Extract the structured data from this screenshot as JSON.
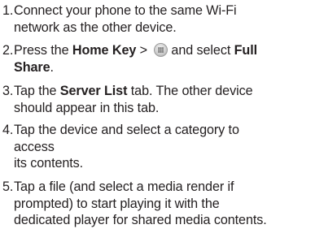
{
  "steps": [
    {
      "number": "1.",
      "lines": [
        "Connect your phone to the same Wi-Fi",
        "network as the other device."
      ]
    },
    {
      "number": "2.",
      "pre": "Press the ",
      "bold1": "Home Key",
      "mid": " > ",
      "icon": "apps-grid-icon",
      "post": "and select ",
      "bold2": "Full",
      "bold3": "Share",
      "end": "."
    },
    {
      "number": "3.",
      "pre": "Tap the ",
      "bold": "Server List",
      "post": " tab. The other device",
      "line2": "should appear in this tab."
    },
    {
      "number": "4.",
      "lines": [
        "Tap the device and select a category to",
        "access",
        "its contents."
      ]
    },
    {
      "number": "5.",
      "lines": [
        "Tap a file (and select a media render if",
        "prompted) to start playing it with the",
        "dedicated player for shared media contents."
      ]
    }
  ]
}
